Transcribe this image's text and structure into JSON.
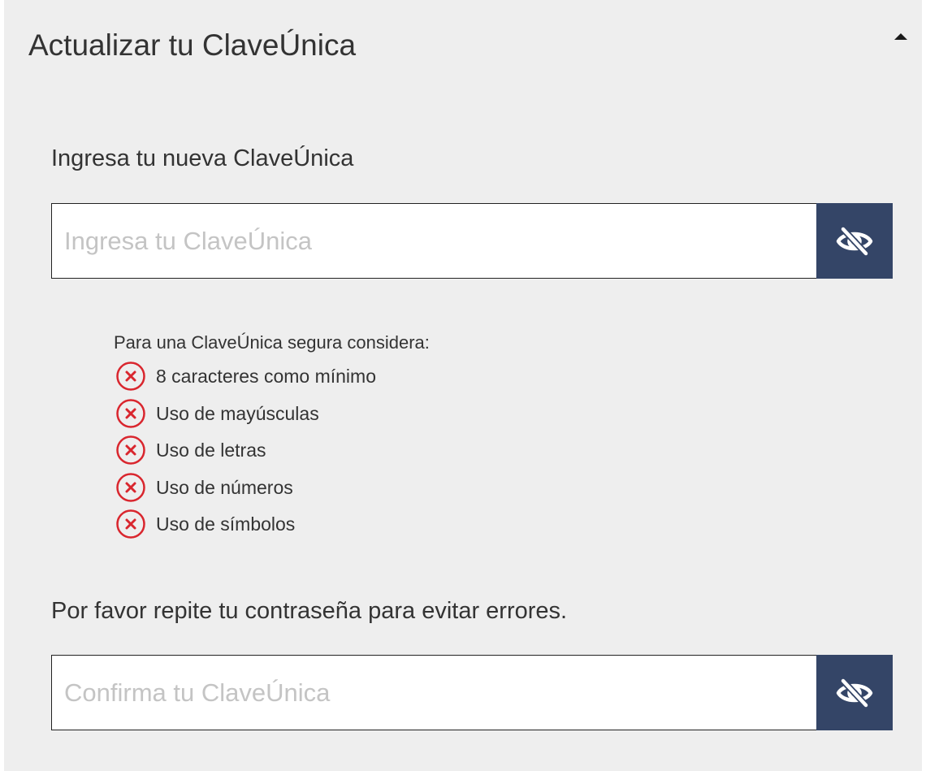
{
  "header": {
    "title": "Actualizar tu ClaveÚnica",
    "collapse_icon": "caret-up-icon"
  },
  "new_password": {
    "label": "Ingresa tu nueva ClaveÚnica",
    "value": "",
    "placeholder": "Ingresa tu ClaveÚnica",
    "toggle_icon": "eye-slash-icon"
  },
  "requirements": {
    "title": "Para una ClaveÚnica segura considera:",
    "status_icon": "x-circle-icon",
    "status_color": "#d9262e",
    "items": [
      {
        "label": "8 caracteres como mínimo",
        "met": false
      },
      {
        "label": "Uso de mayúsculas",
        "met": false
      },
      {
        "label": "Uso de letras",
        "met": false
      },
      {
        "label": "Uso de números",
        "met": false
      },
      {
        "label": "Uso de símbolos",
        "met": false
      }
    ]
  },
  "confirm_password": {
    "label": "Por favor repite tu contraseña para evitar errores.",
    "value": "",
    "placeholder": "Confirma tu ClaveÚnica",
    "toggle_icon": "eye-slash-icon"
  },
  "colors": {
    "panel_background": "#eeeeee",
    "button_background": "#344567",
    "error": "#d9262e",
    "text": "#333333",
    "placeholder": "#c4c4c4"
  }
}
